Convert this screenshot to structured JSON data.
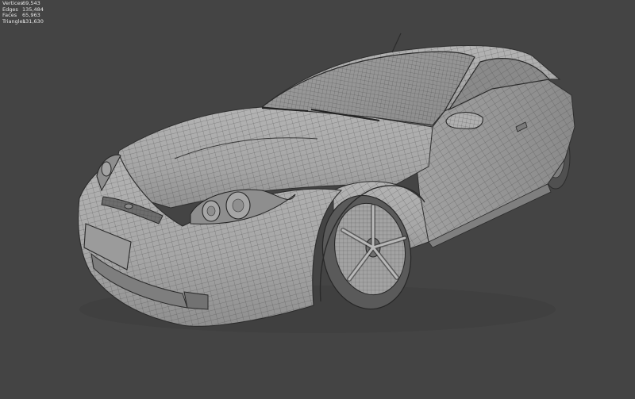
{
  "stats": {
    "vertices": {
      "label": "Vertices",
      "value": "69,543"
    },
    "edges": {
      "label": "Edges",
      "value": "135,484"
    },
    "faces": {
      "label": "Faces",
      "value": "65,963"
    },
    "triangles": {
      "label": "Triangles",
      "value": "131,630"
    }
  },
  "colors": {
    "background": "#444444",
    "stats_text": "#e6e6e6",
    "mesh_fill": "#a9a9a9",
    "wire": "#3c3c3c"
  },
  "scene": {
    "object": "car-model",
    "shading": "solid-with-wireframe"
  }
}
